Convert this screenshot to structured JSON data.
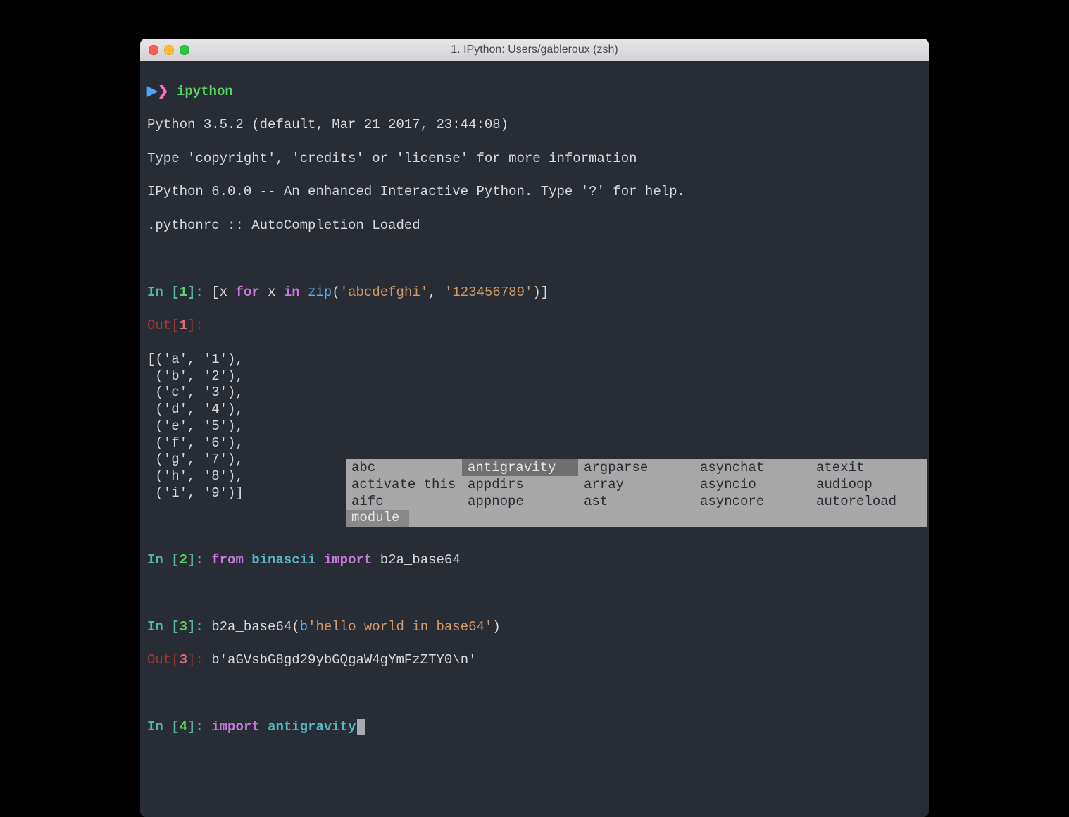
{
  "window": {
    "title": "1. IPython: Users/gableroux (zsh)"
  },
  "shell": {
    "prompt_arrow": "▶",
    "prompt_symbol": "❯",
    "command": "ipython"
  },
  "banner": {
    "line1": "Python 3.5.2 (default, Mar 21 2017, 23:44:08)",
    "line2": "Type 'copyright', 'credits' or 'license' for more information",
    "line3": "IPython 6.0.0 -- An enhanced Interactive Python. Type '?' for help.",
    "line4": ".pythonrc :: AutoCompletion Loaded"
  },
  "cells": {
    "c1": {
      "in_label": "In [",
      "in_num": "1",
      "in_close": "]: ",
      "code_open": "[x ",
      "kw_for": "for",
      "mid1": " x ",
      "kw_in": "in",
      "mid2": " ",
      "fn_zip": "zip",
      "paren_open": "(",
      "str1": "'abcdefghi'",
      "comma": ", ",
      "str2": "'123456789'",
      "paren_close": ")]",
      "out_label": "Out[",
      "out_num": "1",
      "out_close": "]:",
      "output": "[('a', '1'),\n ('b', '2'),\n ('c', '3'),\n ('d', '4'),\n ('e', '5'),\n ('f', '6'),\n ('g', '7'),\n ('h', '8'),\n ('i', '9')]"
    },
    "c2": {
      "in_label": "In [",
      "in_num": "2",
      "in_close": "]: ",
      "kw_from": "from",
      "sp1": " ",
      "mod": "binascii",
      "sp2": " ",
      "kw_import": "import",
      "sp3": " ",
      "name": "b2a_base64"
    },
    "c3": {
      "in_label": "In [",
      "in_num": "3",
      "in_close": "]: ",
      "fn": "b2a_base64",
      "paren_open": "(",
      "byte_prefix": "b",
      "str": "'hello world in base64'",
      "paren_close": ")",
      "out_label": "Out[",
      "out_num": "3",
      "out_close": "]: ",
      "output_prefix": "b",
      "output_str": "'aGVsbG8gd29ybGQgaW4gYmFzZTY0\\n'"
    },
    "c4": {
      "in_label": "In [",
      "in_num": "4",
      "in_close": "]: ",
      "kw_import": "import ",
      "typed": "antigravity"
    }
  },
  "completion": {
    "items": [
      [
        "abc",
        "antigravity",
        "argparse",
        "asynchat",
        "atexit"
      ],
      [
        "activate_this",
        "appdirs",
        "array",
        "asyncio",
        "audioop"
      ],
      [
        "aifc",
        "appnope",
        "ast",
        "asyncore",
        "autoreload"
      ]
    ],
    "selected": "antigravity",
    "meta": "module"
  }
}
